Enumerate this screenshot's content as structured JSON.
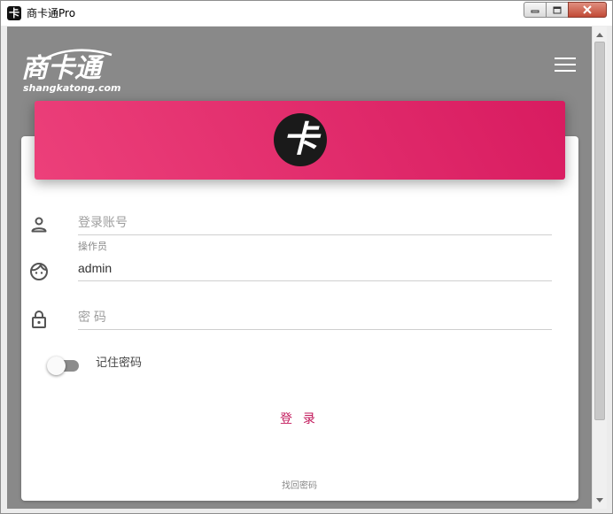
{
  "window": {
    "title": "商卡通Pro",
    "app_icon_glyph": "卡",
    "controls": [
      "minimize-icon",
      "restore-icon",
      "close-icon"
    ]
  },
  "brand": {
    "logo_text": "商卡通",
    "domain": "shangkatong.com"
  },
  "header": {
    "menu_icon": "hamburger-menu-icon"
  },
  "banner": {
    "logo_glyph": "卡",
    "gradient": [
      "#ec407a",
      "#d81b60"
    ]
  },
  "form": {
    "account": {
      "placeholder": "登录账号",
      "value": "",
      "icon": "person-icon"
    },
    "operator": {
      "label": "操作员",
      "value": "admin",
      "icon": "face-icon"
    },
    "password": {
      "placeholder": "密 码",
      "value": "",
      "icon": "lock-icon"
    },
    "remember": {
      "label": "记住密码",
      "checked": false
    },
    "login_label": "登 录",
    "forgot_label": "找回密码"
  },
  "colors": {
    "accent": "#c2185b",
    "background": "#898989",
    "card": "#ffffff"
  }
}
